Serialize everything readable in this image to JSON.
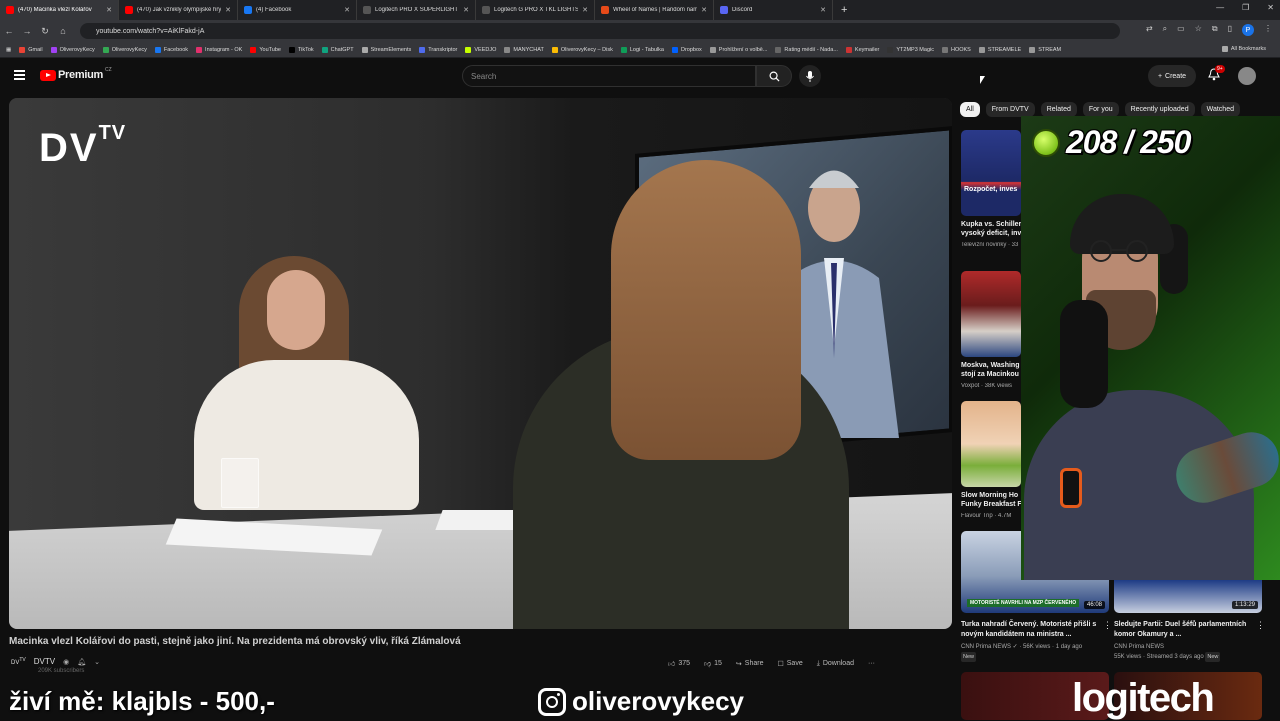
{
  "browser": {
    "tabs": [
      {
        "title": "(470) Macinka vlezl Kolářov",
        "fav": "#ff0000",
        "active": true
      },
      {
        "title": "(470) Jak vznikly olympijské hry",
        "fav": "#ff0000",
        "active": false
      },
      {
        "title": "(4) Facebook",
        "fav": "#1877f2",
        "active": false
      },
      {
        "title": "Logitech PRO X SUPERLIGHT 2",
        "fav": "#555555",
        "active": false
      },
      {
        "title": "Logitech G PRO X TKL LIGHTSP",
        "fav": "#555555",
        "active": false
      },
      {
        "title": "Wheel of Names | Random nam",
        "fav": "#e64a19",
        "active": false
      },
      {
        "title": "Discord",
        "fav": "#5865f2",
        "active": false
      }
    ],
    "url": "youtube.com/watch?v=AiKlFakd-jA",
    "profile_initial": "P",
    "bookmarks": [
      {
        "label": "Gmail",
        "color": "#ea4335"
      },
      {
        "label": "OliverovyKecy",
        "color": "#a142f4"
      },
      {
        "label": "OliverovyKecy",
        "color": "#34a853"
      },
      {
        "label": "Facebook",
        "color": "#1877f2"
      },
      {
        "label": "Instagram - OK",
        "color": "#e1306c"
      },
      {
        "label": "YouTube",
        "color": "#ff0000"
      },
      {
        "label": "TikTok",
        "color": "#000000"
      },
      {
        "label": "ChatGPT",
        "color": "#10a37f"
      },
      {
        "label": "StreamElements",
        "color": "#aaaaaa"
      },
      {
        "label": "Transkriptor",
        "color": "#4f6bed"
      },
      {
        "label": "VEEDJO",
        "color": "#c6ff00"
      },
      {
        "label": "MANYCHAT",
        "color": "#888888"
      },
      {
        "label": "OliverovyKecy – Disk",
        "color": "#fbbc04"
      },
      {
        "label": "Logi - Tabulka",
        "color": "#0f9d58"
      },
      {
        "label": "Dropbox",
        "color": "#0061ff"
      },
      {
        "label": "Prohlížení o volbě...",
        "color": "#999999"
      },
      {
        "label": "Rating médií - Nada...",
        "color": "#666666"
      },
      {
        "label": "Keymailer",
        "color": "#cc3333"
      },
      {
        "label": "YT2MP3 Magic",
        "color": "#333333"
      },
      {
        "label": "HOOKS",
        "color": "#777777"
      },
      {
        "label": "STREAMELE",
        "color": "#999999"
      },
      {
        "label": "STREAM",
        "color": "#999999"
      }
    ],
    "all_bookmarks": "All Bookmarks"
  },
  "youtube": {
    "logo": "Premium",
    "logo_region": "CZ",
    "search_placeholder": "Search",
    "create_label": "Create",
    "notif_count": "9+",
    "video_title": "Macinka vlezl Kolářovi do pasti, stejně jako jiní. Na prezidenta má obrovský vliv, říká Zlámalová",
    "channel": "DVTV",
    "subscribers": "209K subscribers",
    "likes": "375",
    "dislikes": "15",
    "share": "Share",
    "save": "Save",
    "download": "Download",
    "player_logo": "DV",
    "player_logo_sup": "TV",
    "chips": [
      "All",
      "From DVTV",
      "Related",
      "For you",
      "Recently uploaded",
      "Watched"
    ],
    "sidebar": [
      {
        "title": "Kupka vs. Schiller",
        "line2": "vysoký deficit, inv",
        "meta": "Televizní novinky · 33",
        "thumb_text": "Rozpočet, inves"
      },
      {
        "title": "Moskva, Washing",
        "line2": "stojí za Macinkou",
        "meta": "Voxpot · 38K views"
      },
      {
        "title": "Slow Morning Ho",
        "line2": "Funky Breakfast F",
        "meta": "Flavour Trip · 4.7M"
      }
    ],
    "bottom_videos": [
      {
        "title": "Turka nahradí Červený. Motoristé přišli s novým kandidátem na ministra ...",
        "channel": "CNN Prima NEWS",
        "meta": "56K views · 1 day ago",
        "badge": "New",
        "duration": "46:08",
        "caption": "MOTORISTÉ NAVRHLI NA MZP ČERVENÉHO"
      },
      {
        "title": "Sledujte Partii: Duel šéfů parlamentních komor Okamury a ...",
        "channel": "CNN Prima NEWS",
        "meta": "55K views · Streamed 3 days ago",
        "badge": "New",
        "duration": "1:13:29"
      }
    ]
  },
  "stream": {
    "counter": "208 / 250",
    "overlay_left": "živí mě: klajbls - 500,-",
    "instagram": "oliverovykecy",
    "sponsor": "logitech"
  }
}
